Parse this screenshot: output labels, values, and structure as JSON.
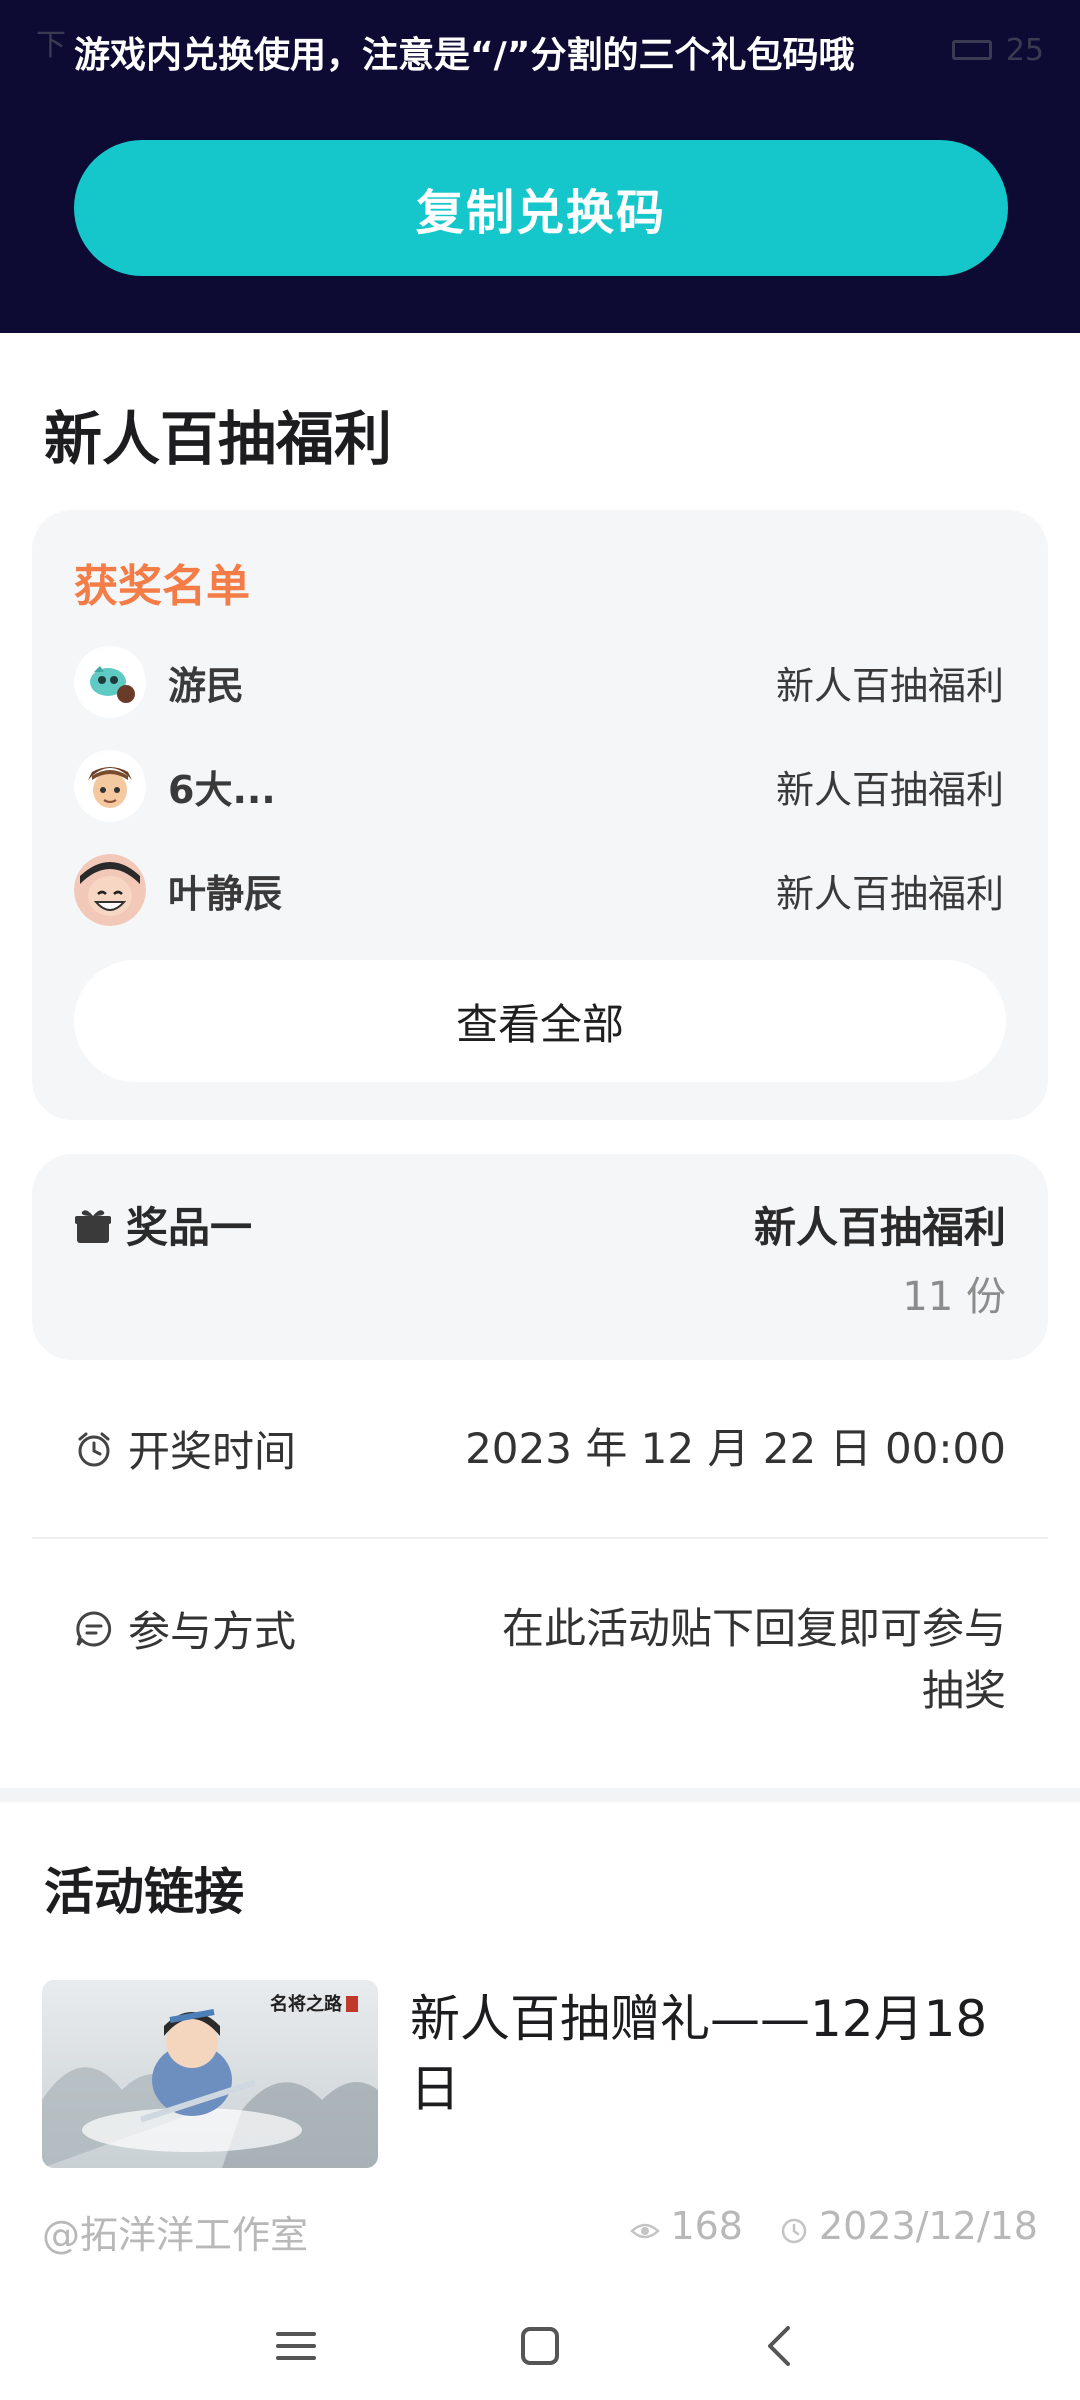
{
  "status_bar": {
    "left_text": "下",
    "right_text": "25"
  },
  "header": {
    "hint_text": "游戏内兑换使用，注意是“/”分割的三个礼包码哦",
    "copy_button_label": "复制兑换码"
  },
  "lottery": {
    "title": "新人百抽福利",
    "winners": {
      "title": "获奖名单",
      "rows": [
        {
          "name": "游民",
          "prize": "新人百抽福利"
        },
        {
          "name": "6大...",
          "prize": "新人百抽福利"
        },
        {
          "name": "叶静辰",
          "prize": "新人百抽福利"
        }
      ],
      "view_all_label": "查看全部"
    },
    "prize": {
      "label": "奖品一",
      "name": "新人百抽福利",
      "count": "11 份"
    },
    "draw_time": {
      "label": "开奖时间",
      "value": "2023 年 12 月 22 日 00:00"
    },
    "participation": {
      "label": "参与方式",
      "value_line1": "在此活动贴下回复即可参与",
      "value_line2": "抽奖"
    }
  },
  "activity_link": {
    "section_title": "活动链接",
    "title_line1": "新人百抽赠礼——12月18",
    "title_line2": "日",
    "author": "@拓洋洋工作室",
    "views": "168",
    "date": "2023/12/18",
    "thumb_logo_text": "名将之路"
  },
  "colors": {
    "header_bg": "#0d0b33",
    "accent": "#15c6cb",
    "winners_title": "#f37c47"
  }
}
